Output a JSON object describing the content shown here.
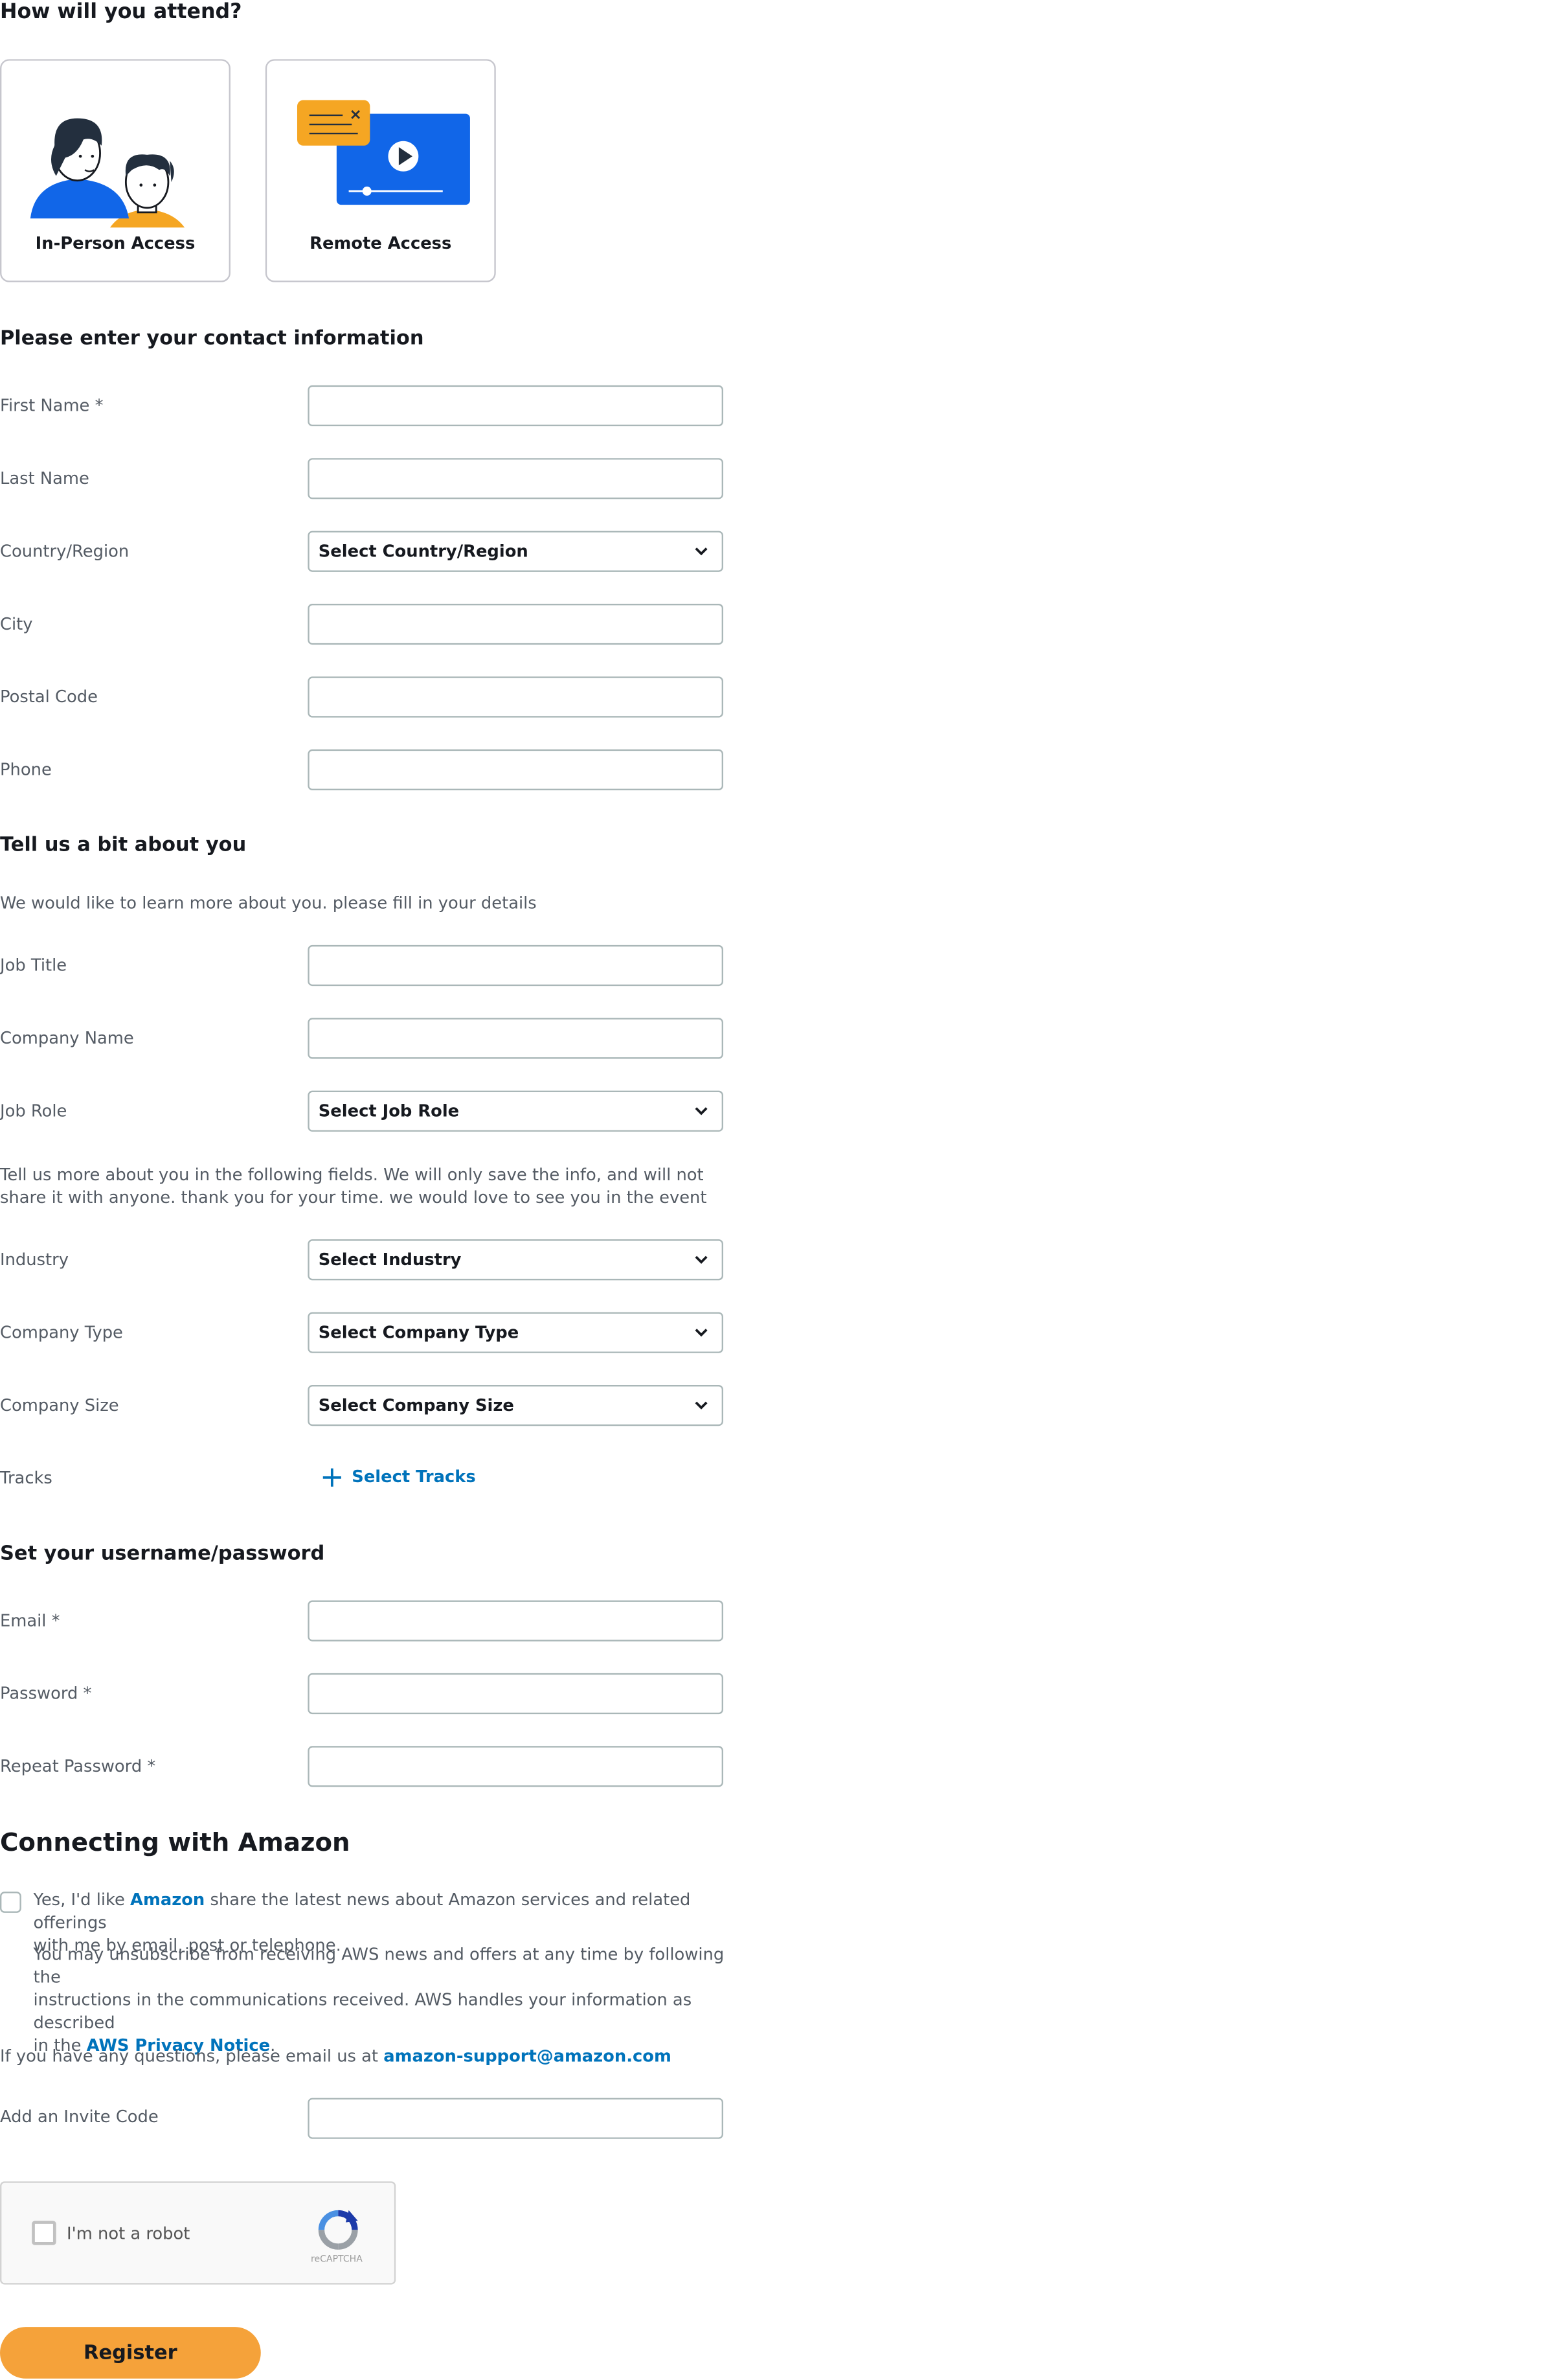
{
  "attendance": {
    "heading": "How will you attend?",
    "options": [
      {
        "label": "In-Person Access",
        "icon": "people-icon"
      },
      {
        "label": "Remote Access",
        "icon": "video-player-icon"
      }
    ]
  },
  "contact": {
    "heading": "Please enter your contact information",
    "first_name_label": "First Name *",
    "last_name_label": "Last Name",
    "country_label": "Country/Region",
    "country_value": "Select Country/Region",
    "city_label": "City",
    "postal_label": "Postal Code",
    "phone_label": "Phone"
  },
  "about": {
    "heading": "Tell us a bit about you",
    "intro": "We would like to learn more about you. please fill in your details",
    "job_title_label": "Job Title",
    "company_name_label": "Company Name",
    "job_role_label": "Job Role",
    "job_role_value": "Select Job Role",
    "more_line1": "Tell us more about you in the following fields. We will only save the info, and will not",
    "more_line2": "share it with anyone. thank you for your time. we would love to see you in the event",
    "industry_label": "Industry",
    "industry_value": "Select Industry",
    "company_type_label": "Company Type",
    "company_type_value": "Select Company Type",
    "company_size_label": "Company Size",
    "company_size_value": "Select Company Size",
    "tracks_label": "Tracks",
    "tracks_link": "Select Tracks"
  },
  "credentials": {
    "heading": "Set your username/password",
    "email_label": "Email *",
    "password_label": "Password *",
    "repeat_label": "Repeat Password *"
  },
  "connect": {
    "heading": "Connecting with Amazon",
    "consent_pre": "Yes, I'd like ",
    "consent_link": "Amazon",
    "consent_post": " share the latest news about Amazon services and related offerings",
    "consent_line2": "with me by email, post or telephone.",
    "unsub_line1": "You may unsubscribe from receiving AWS news and offers at any time by following the",
    "unsub_line2": "instructions in the communications received.  AWS handles your information as described",
    "unsub_line3_pre": "in the ",
    "privacy_link": "AWS Privacy Notice",
    "unsub_line3_post": ".",
    "questions_pre": "If you have any questions, please email us at ",
    "support_email": "amazon-support@amazon.com",
    "invite_label": "Add an Invite Code"
  },
  "captcha": {
    "label": "I'm not a robot",
    "brand": "reCAPTCHA"
  },
  "register_label": "Register",
  "colors": {
    "accent_orange": "#f5a23a",
    "link_blue": "#0073bb",
    "illustration_blue": "#1166e8",
    "illustration_orange": "#f5a623"
  }
}
